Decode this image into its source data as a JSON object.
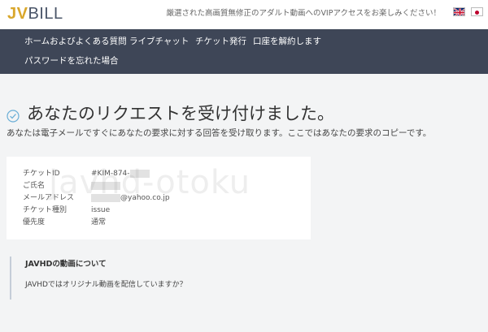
{
  "header": {
    "logo_part1": "JV",
    "logo_part2": "BILL",
    "tagline": "厳選された高画質無修正のアダルト動画へのVIPアクセスをお楽しみください！",
    "languages": [
      "en-flag-icon",
      "jp-flag-icon"
    ]
  },
  "nav": {
    "items": [
      {
        "label": "ホームおよびよくある質問"
      },
      {
        "label": "ライブチャット"
      },
      {
        "label": "チケット発行"
      },
      {
        "label": "口座を解約します"
      },
      {
        "label": "パスワードを忘れた場合"
      }
    ]
  },
  "main": {
    "title": "あなたのリクエストを受け付けました。",
    "subtitle": "あなたは電子メールですぐにあなたの要求に対する回答を受け取ります。ここではあなたの要求のコピーです。",
    "details": [
      {
        "label": "チケットID",
        "value": "#KIM-874-"
      },
      {
        "label": "ご氏名",
        "value": ""
      },
      {
        "label": "メールアドレス",
        "value": "@yahoo.co.jp"
      },
      {
        "label": "チケット種別",
        "value": "issue"
      },
      {
        "label": "優先度",
        "value": "通常"
      }
    ],
    "watermark": "javhd-otoku",
    "notice": {
      "title": "JAVHDの動画について",
      "text": "JAVHDではオリジナル動画を配信していますか？"
    }
  },
  "colors": {
    "nav_bg": "#3e4657",
    "logo_accent": "#d9a72c",
    "check_icon": "#6aaed6",
    "page_bg": "#f3f4f5"
  }
}
